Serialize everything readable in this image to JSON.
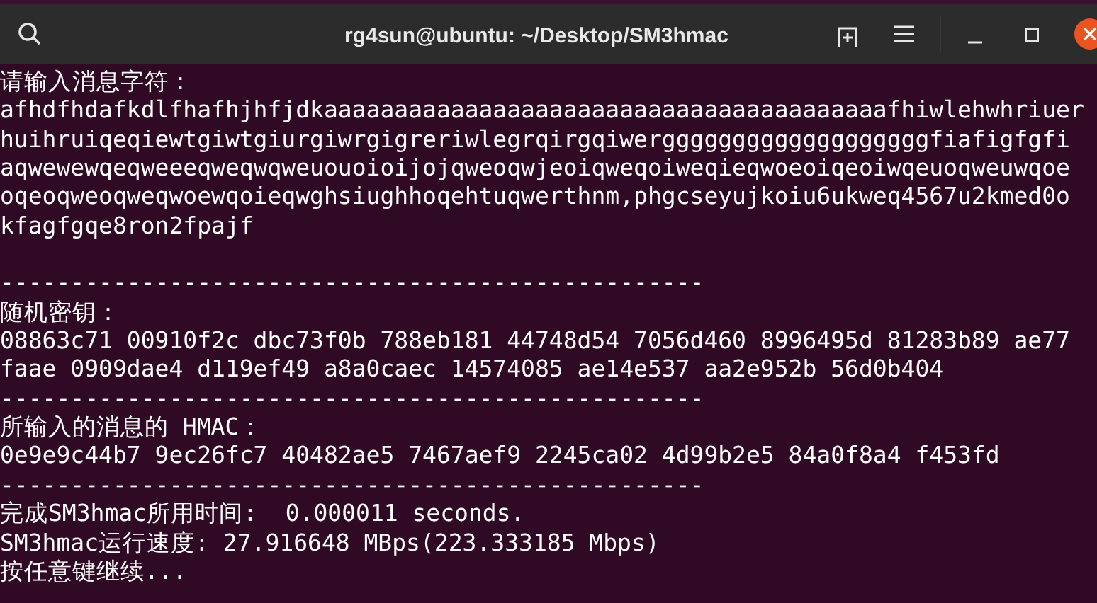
{
  "window": {
    "title": "rg4sun@ubuntu: ~/Desktop/SM3hmac"
  },
  "lines": [
    {
      "kind": "text",
      "text": "请输入消息字符："
    },
    {
      "kind": "text",
      "text": "afhdfhdafkdlfhafhjhfjdkaaaaaaaaaaaaaaaaaaaaaaaaaaaaaaaaaaaaaaaafhiwlehwhriuer"
    },
    {
      "kind": "text",
      "text": "huihruiqeqiewtgiwtgiurgiwrgigreriwlegrqirgqiwergggggggggggggggggggfiafigfgfi"
    },
    {
      "kind": "text",
      "text": "aqwewewqeqweeeqweqwqweuouoioijojqweoqwjeoiqweqoiweqieqwoeoiqeoiwqeuoqweuwqoe"
    },
    {
      "kind": "text",
      "text": "oqeoqweoqweqwoewqoieqwghsiughhoqehtuqwerthnm,phgcseyujkoiu6ukweq4567u2kmed0o"
    },
    {
      "kind": "text",
      "text": "kfagfgqe8ron2fpajf"
    },
    {
      "kind": "blank"
    },
    {
      "kind": "text",
      "text": "--------------------------------------------------"
    },
    {
      "kind": "text",
      "text": "随机密钥："
    },
    {
      "kind": "text",
      "text": "08863c71 00910f2c dbc73f0b 788eb181 44748d54 7056d460 8996495d 81283b89 ae77"
    },
    {
      "kind": "text",
      "text": "faae 0909dae4 d119ef49 a8a0caec 14574085 ae14e537 aa2e952b 56d0b404"
    },
    {
      "kind": "text",
      "text": "--------------------------------------------------"
    },
    {
      "kind": "text",
      "text": "所输入的消息的 HMAC："
    },
    {
      "kind": "text",
      "text": "0e9e9c44b7 9ec26fc7 40482ae5 7467aef9 2245ca02 4d99b2e5 84a0f8a4 f453fd"
    },
    {
      "kind": "text",
      "text": "--------------------------------------------------"
    },
    {
      "kind": "text",
      "text": "完成SM3hmac所用时间:  0.000011 seconds."
    },
    {
      "kind": "text",
      "text": "SM3hmac运行速度: 27.916648 MBps(223.333185 Mbps)"
    },
    {
      "kind": "text",
      "text": "按任意键继续..."
    }
  ]
}
